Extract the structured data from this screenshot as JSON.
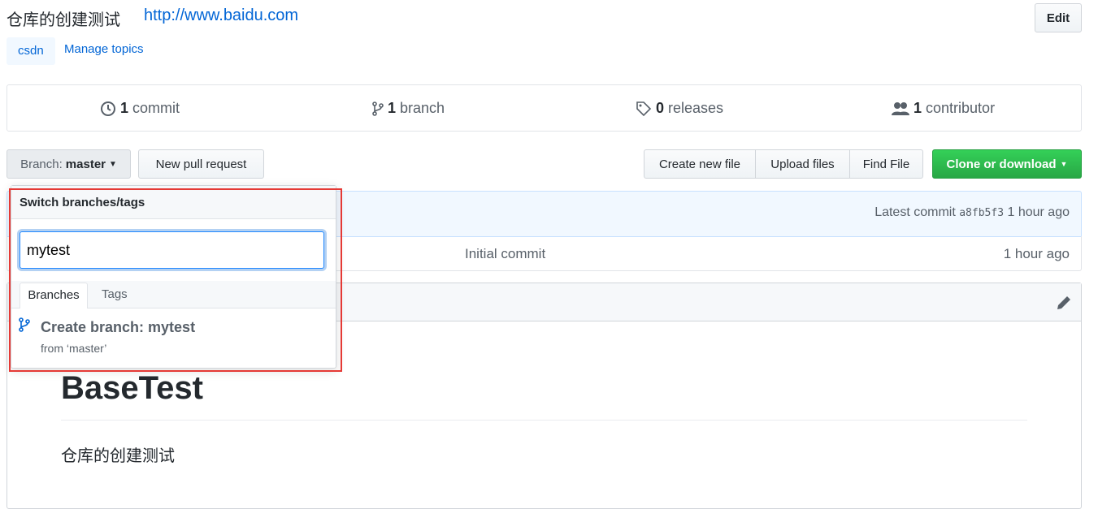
{
  "repo": {
    "description": "仓库的创建测试",
    "website": "http://www.baidu.com",
    "edit_label": "Edit",
    "topics": [
      "csdn"
    ],
    "manage_topics": "Manage topics"
  },
  "stats": [
    {
      "icon": "history-icon",
      "count": "1",
      "label": "commit"
    },
    {
      "icon": "branch-icon",
      "count": "1",
      "label": "branch"
    },
    {
      "icon": "tag-icon",
      "count": "0",
      "label": "releases"
    },
    {
      "icon": "people-icon",
      "count": "1",
      "label": "contributor"
    }
  ],
  "toolbar": {
    "branch_prefix": "Branch:",
    "branch_name": "master",
    "new_pr": "New pull request",
    "create_file": "Create new file",
    "upload": "Upload files",
    "find": "Find File",
    "clone": "Clone or download"
  },
  "commit_bar": {
    "prefix": "Latest commit",
    "sha": "a8fb5f3",
    "time": "1 hour ago"
  },
  "file_row": {
    "message": "Initial commit",
    "time": "1 hour ago"
  },
  "readme": {
    "heading": "BaseTest",
    "body": "仓库的创建测试"
  },
  "dropdown": {
    "title": "Switch branches/tags",
    "filter_value": "mytest",
    "tabs": [
      "Branches",
      "Tags"
    ],
    "create_label": "Create branch: mytest",
    "from_label": "from ‘master’"
  },
  "colors": {
    "accent": "#0366d6",
    "green": "#28a745",
    "highlight": "#e53935"
  }
}
